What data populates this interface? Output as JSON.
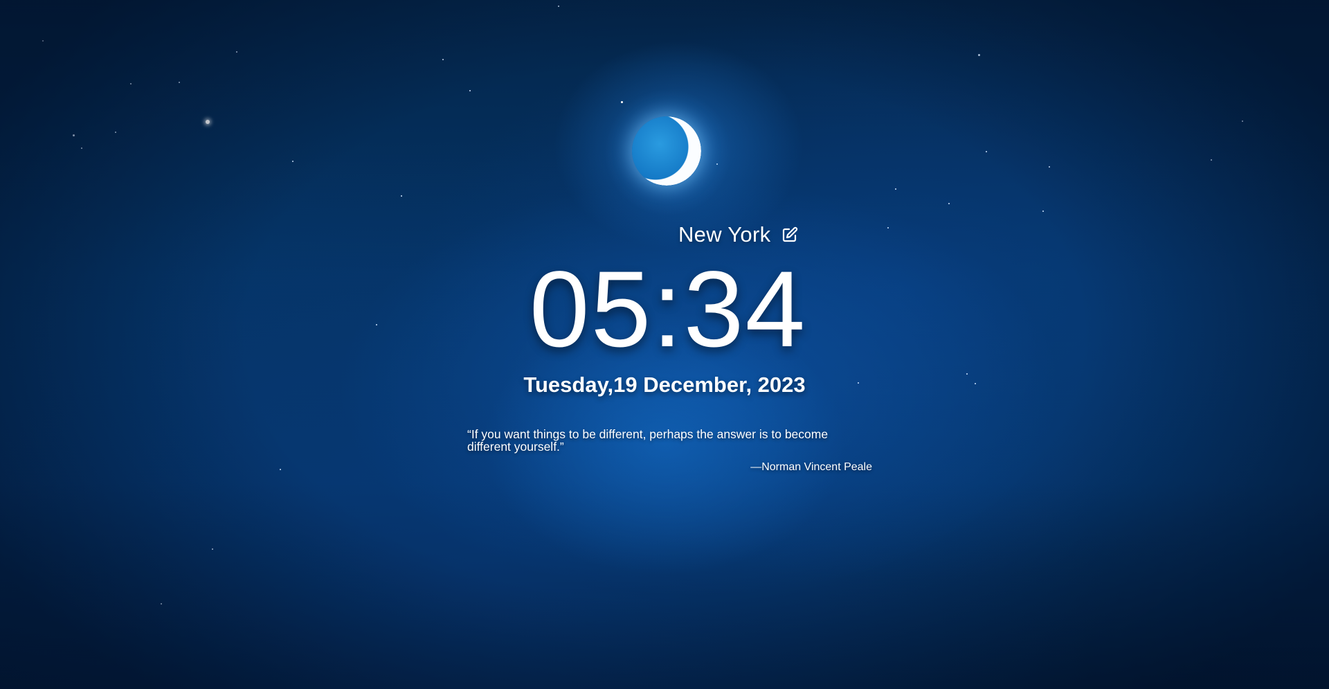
{
  "location": {
    "city": "New York",
    "edit_icon": "edit-icon"
  },
  "clock": {
    "time": "05:34",
    "date": "Tuesday,19 December, 2023"
  },
  "quote": {
    "text": "“If you want things to be different, perhaps the answer is to become different yourself.”",
    "author": "—Norman Vincent Peale"
  },
  "colors": {
    "sky": "#05356a",
    "text": "#ffffff"
  }
}
